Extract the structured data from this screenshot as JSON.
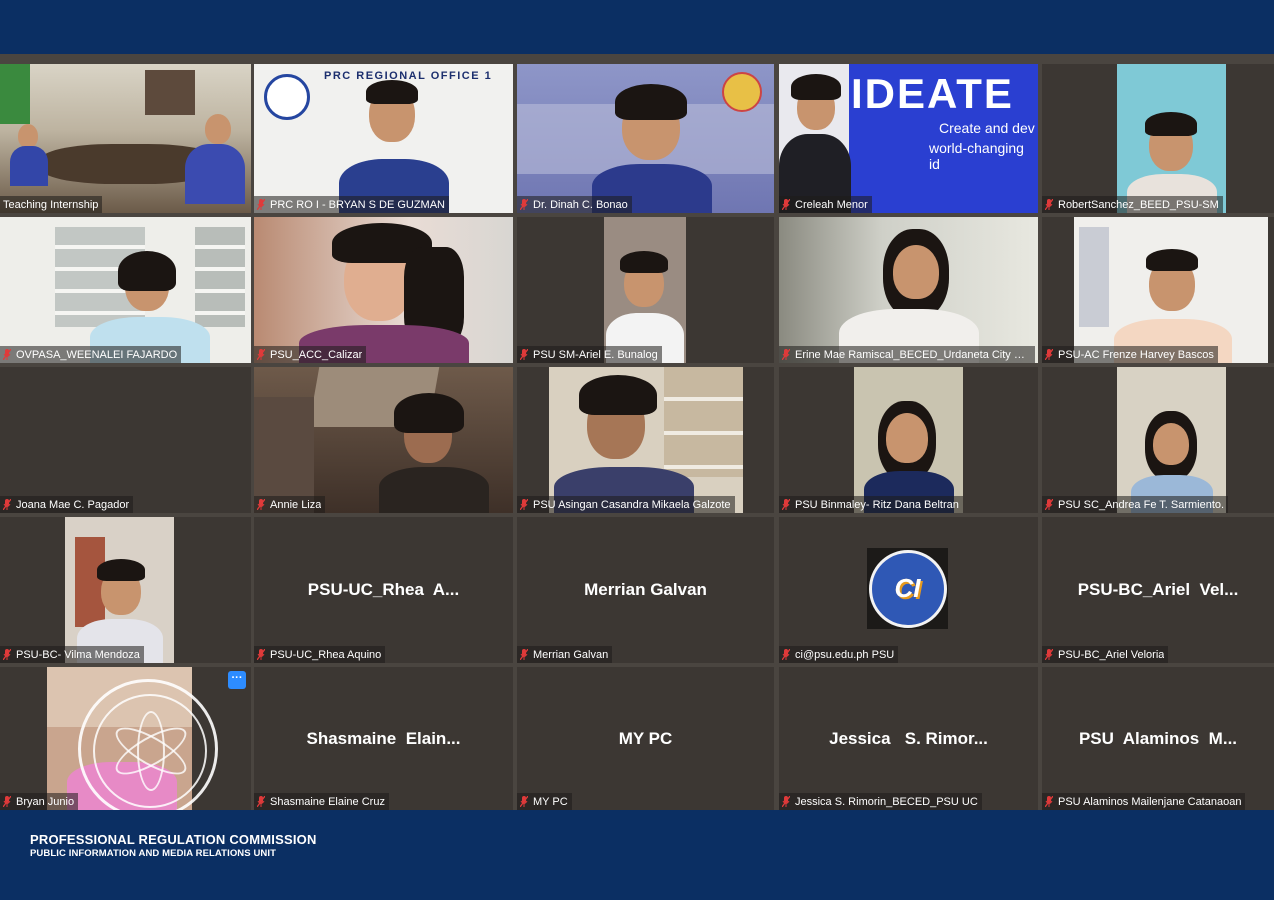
{
  "meeting": {
    "participants": [
      {
        "name": "Teaching Internship"
      },
      {
        "name": "PRC RO I - BRYAN S DE GUZMAN"
      },
      {
        "name": "Dr. Dinah C. Bonao"
      },
      {
        "name": "Creleah Menor"
      },
      {
        "name": "RobertSanchez_BEED_PSU-SM"
      },
      {
        "name": "OVPASA_WEENALEI FAJARDO"
      },
      {
        "name": "PSU_ACC_Calizar"
      },
      {
        "name": "PSU SM-Ariel E. Bunalog"
      },
      {
        "name": "Erine Mae Ramiscal_BECED_Urdaneta City Ca..."
      },
      {
        "name": "PSU-AC Frenze Harvey Bascos"
      },
      {
        "name": "Joana Mae C. Pagador"
      },
      {
        "name": "Annie Liza"
      },
      {
        "name": "PSU Asingan Casandra Mikaela Galzote"
      },
      {
        "name": "PSU Binmaley- Ritz Dana Beltran"
      },
      {
        "name": "PSU SC_Andrea Fe T. Sarmiento."
      },
      {
        "name": "PSU-BC- Vilma Mendoza"
      },
      {
        "name": "PSU-UC_Rhea Aquino",
        "display": "PSU-UC_Rhea  A..."
      },
      {
        "name": "Merrian Galvan",
        "display": "Merrian Galvan"
      },
      {
        "name": "ci@psu.edu.ph PSU"
      },
      {
        "name": "PSU-BC_Ariel Veloria",
        "display": "PSU-BC_Ariel  Vel..."
      },
      {
        "name": "Bryan Junio"
      },
      {
        "name": "Shasmaine Elaine Cruz",
        "display": "Shasmaine  Elain..."
      },
      {
        "name": "MY PC",
        "display": "MY PC"
      },
      {
        "name": "Jessica  S. Rimorin_BECED_PSU UC",
        "display": "Jessica   S. Rimor..."
      },
      {
        "name": "PSU Alaminos Mailenjane Catanaoan",
        "display": "PSU  Alaminos  M..."
      }
    ],
    "more_button_label": "···",
    "backgrounds": {
      "prc_banner": "PRC REGIONAL OFFICE 1",
      "ideate_title": "IDEATE",
      "ideate_sub1": "Create and dev",
      "ideate_sub2": "world-changing id",
      "ci_logo": "CI"
    }
  },
  "footer": {
    "org": "PROFESSIONAL REGULATION COMMISSION",
    "unit": "PUBLIC INFORMATION AND MEDIA RELATIONS UNIT"
  },
  "colors": {
    "frame_blue": "#0b2f63",
    "tile_bg": "#3c3733",
    "grid_gap": "#4a4540",
    "active_speaker": "#e6e33a",
    "muted_mic": "#e03a3a",
    "more_button": "#2d8cff"
  }
}
